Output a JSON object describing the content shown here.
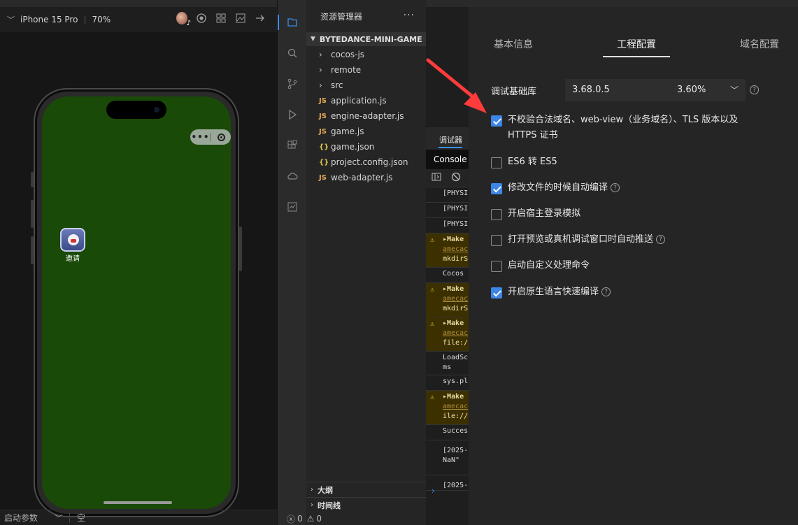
{
  "simulator": {
    "device": "iPhone 15 Pro",
    "zoom": "70%",
    "capsule_more": "•••",
    "invite_label": "邀请",
    "params_label": "启动参数",
    "params_value": "空"
  },
  "explorer": {
    "title": "资源管理器",
    "more": "···",
    "project": "BYTEDANCE-MINI-GAME",
    "items": [
      {
        "type": "folder",
        "name": "cocos-js"
      },
      {
        "type": "folder",
        "name": "remote"
      },
      {
        "type": "folder",
        "name": "src"
      },
      {
        "type": "js",
        "name": "application.js"
      },
      {
        "type": "js",
        "name": "engine-adapter.js"
      },
      {
        "type": "js",
        "name": "game.js"
      },
      {
        "type": "json",
        "name": "game.json"
      },
      {
        "type": "json",
        "name": "project.config.json"
      },
      {
        "type": "js",
        "name": "web-adapter.js"
      }
    ],
    "outline": "大纲",
    "timeline": "时间线",
    "errors": "0",
    "warnings": "0"
  },
  "debugger": {
    "tab": "调试器",
    "console_tab": "Console",
    "logs": [
      {
        "kind": "plain",
        "lines": [
          "[PHYSI"
        ]
      },
      {
        "kind": "plain",
        "lines": [
          "[PHYSI"
        ]
      },
      {
        "kind": "plain",
        "lines": [
          "[PHYSI"
        ]
      },
      {
        "kind": "warn",
        "lines": [
          "▸Make",
          "amecac",
          "mkdirS"
        ]
      },
      {
        "kind": "plain",
        "lines": [
          "Cocos"
        ]
      },
      {
        "kind": "warn",
        "lines": [
          "▸Make",
          "amecac",
          "mkdirS"
        ]
      },
      {
        "kind": "warn",
        "lines": [
          "▸Make",
          "amecac",
          "file:/"
        ]
      },
      {
        "kind": "plain",
        "lines": [
          "LoadSc",
          "ms"
        ]
      },
      {
        "kind": "plain",
        "lines": [
          "sys.pl"
        ]
      },
      {
        "kind": "warn",
        "lines": [
          "▸Make",
          "amecac",
          "ile://"
        ]
      },
      {
        "kind": "plain",
        "lines": [
          "Succes"
        ]
      },
      {
        "kind": "plain",
        "lines": [
          "[2025-",
          "NaN\""
        ]
      },
      {
        "kind": "plain",
        "lines": [
          "[2025-"
        ]
      }
    ],
    "prompt": "›"
  },
  "settings": {
    "tabs": [
      "基本信息",
      "工程配置",
      "域名配置"
    ],
    "active_tab": 1,
    "lib_label": "调试基础库",
    "lib_version": "3.68.0.5",
    "lib_share": "3.60%",
    "options": [
      {
        "line1": "不校验合法域名、web-view（业务域名）、TLS 版本以及",
        "line2": "HTTPS 证书",
        "checked": true,
        "help": false
      },
      {
        "line1": "ES6 转 ES5",
        "checked": false,
        "help": false
      },
      {
        "line1": "修改文件的时候自动编译",
        "checked": true,
        "help": true
      },
      {
        "line1": "开启宿主登录模拟",
        "checked": false,
        "help": false
      },
      {
        "line1": "打开预览或真机调试窗口时自动推送",
        "checked": false,
        "help": true
      },
      {
        "line1": "启动自定义处理命令",
        "checked": false,
        "help": false
      },
      {
        "line1": "开启原生语言快速编译",
        "checked": true,
        "help": true
      }
    ]
  },
  "colors": {
    "accent": "#3d86e6",
    "game_bg": "#1a4a07",
    "annotation_arrow": "#ff3b3b"
  }
}
